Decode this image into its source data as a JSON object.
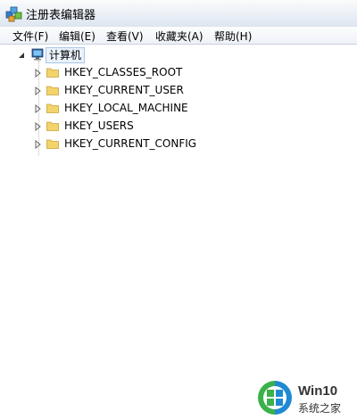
{
  "window": {
    "title": "注册表编辑器"
  },
  "menubar": {
    "items": [
      {
        "label": "文件(F)"
      },
      {
        "label": "编辑(E)"
      },
      {
        "label": "查看(V)"
      },
      {
        "label": "收藏夹(A)"
      },
      {
        "label": "帮助(H)"
      }
    ]
  },
  "tree": {
    "root": {
      "label": "计算机",
      "icon": "computer-icon"
    },
    "children": [
      {
        "label": "HKEY_CLASSES_ROOT",
        "icon": "folder-icon"
      },
      {
        "label": "HKEY_CURRENT_USER",
        "icon": "folder-icon"
      },
      {
        "label": "HKEY_LOCAL_MACHINE",
        "icon": "folder-icon"
      },
      {
        "label": "HKEY_USERS",
        "icon": "folder-icon"
      },
      {
        "label": "HKEY_CURRENT_CONFIG",
        "icon": "folder-icon"
      }
    ]
  },
  "watermark": {
    "name": "Win10",
    "subtitle": "系统之家",
    "colors": {
      "green": "#3bb14a",
      "blue": "#1e8ad3"
    }
  }
}
